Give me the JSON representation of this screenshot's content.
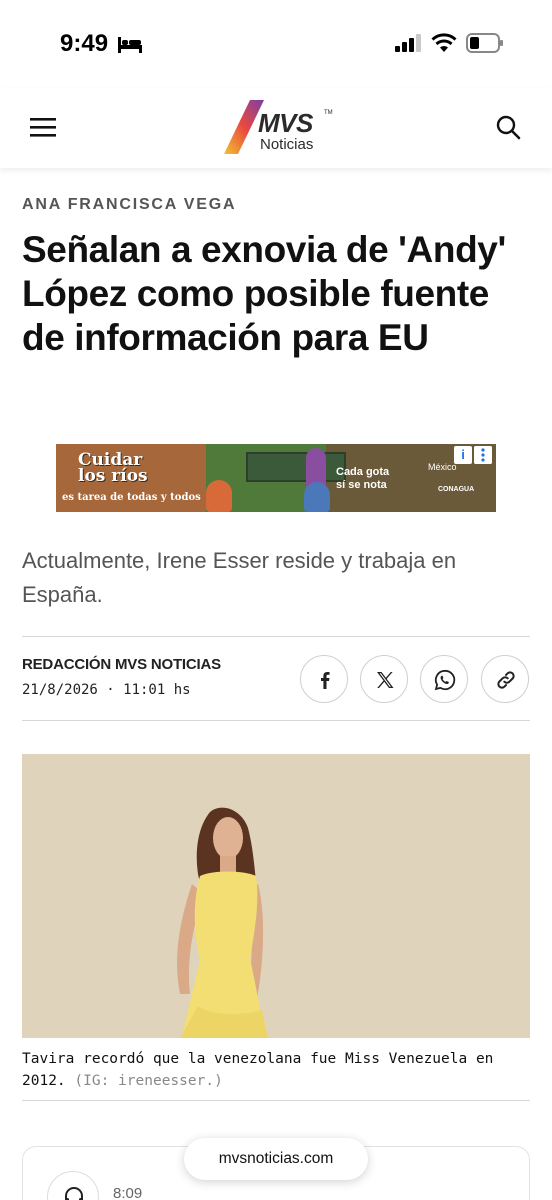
{
  "status_bar": {
    "time": "9:49"
  },
  "header": {
    "logo_main": "MVS",
    "logo_tm": "TM",
    "logo_sub": "Noticias"
  },
  "article": {
    "author_tag": "ANA FRANCISCA VEGA",
    "headline": "Señalan a exnovia de 'Andy' López como posible fuente de información para EU",
    "summary": "Actualmente, Irene Esser reside y trabaja en España.",
    "byline": "REDACCIÓN MVS NOTICIAS",
    "pubdate": "21/8/2026 · 11:01 hs",
    "caption": "Tavira recordó que la venezolana fue Miss Venezuela en 2012.",
    "caption_credit": "(IG: ireneesser.)"
  },
  "ad": {
    "title_line1": "Cuidar",
    "title_line2": "los ríos",
    "subtitle": "es tarea de todas y todos",
    "slogan_line1": "Cada gota",
    "slogan_line2": "sí se nota",
    "gov_label": "México",
    "agency_label": "CONAGUA",
    "info_glyph": "i"
  },
  "share": {
    "buttons": [
      "facebook-icon",
      "x-icon",
      "whatsapp-icon",
      "link-icon"
    ]
  },
  "audio": {
    "time": "8:09"
  },
  "browser": {
    "url": "mvsnoticias.com"
  },
  "colors": {
    "logo_gradient": [
      "#f2c230",
      "#e8493f",
      "#7a3ea8"
    ],
    "text_primary": "#111111",
    "text_secondary": "#555555"
  }
}
